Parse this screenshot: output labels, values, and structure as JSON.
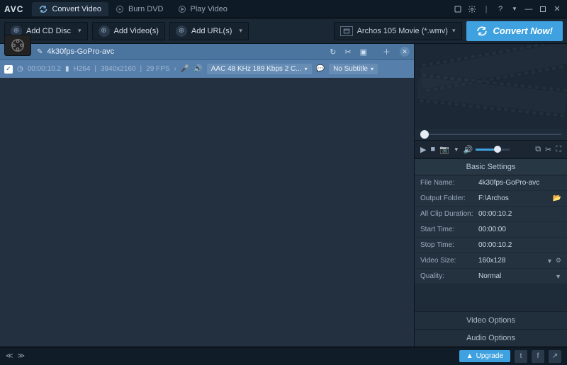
{
  "app": {
    "logo": "AVC"
  },
  "tabs": {
    "convert": "Convert Video",
    "burn": "Burn DVD",
    "play": "Play Video"
  },
  "toolbar": {
    "add_cd": "Add CD Disc",
    "add_video": "Add Video(s)",
    "add_url": "Add URL(s)",
    "output_profile": "Archos 105 Movie (*.wmv)",
    "convert": "Convert Now!"
  },
  "file": {
    "title": "4k30fps-GoPro-avc",
    "duration": "00:00:10.2",
    "codec": "H264",
    "resolution": "3840x2160",
    "fps": "29 FPS",
    "audio": "AAC 48 KHz 189 Kbps 2 C...",
    "subtitle": "No Subtitle"
  },
  "settings": {
    "header": "Basic Settings",
    "file_name_label": "File Name:",
    "file_name": "4k30fps-GoPro-avc",
    "output_folder_label": "Output Folder:",
    "output_folder": "F:\\Archos",
    "all_clip_label": "All Clip Duration:",
    "all_clip": "00:00:10.2",
    "start_label": "Start Time:",
    "start": "00:00:00",
    "stop_label": "Stop Time:",
    "stop": "00:00:10.2",
    "video_size_label": "Video Size:",
    "video_size": "160x128",
    "quality_label": "Quality:",
    "quality": "Normal"
  },
  "options": {
    "video": "Video Options",
    "audio": "Audio Options"
  },
  "status": {
    "upgrade": "Upgrade"
  }
}
